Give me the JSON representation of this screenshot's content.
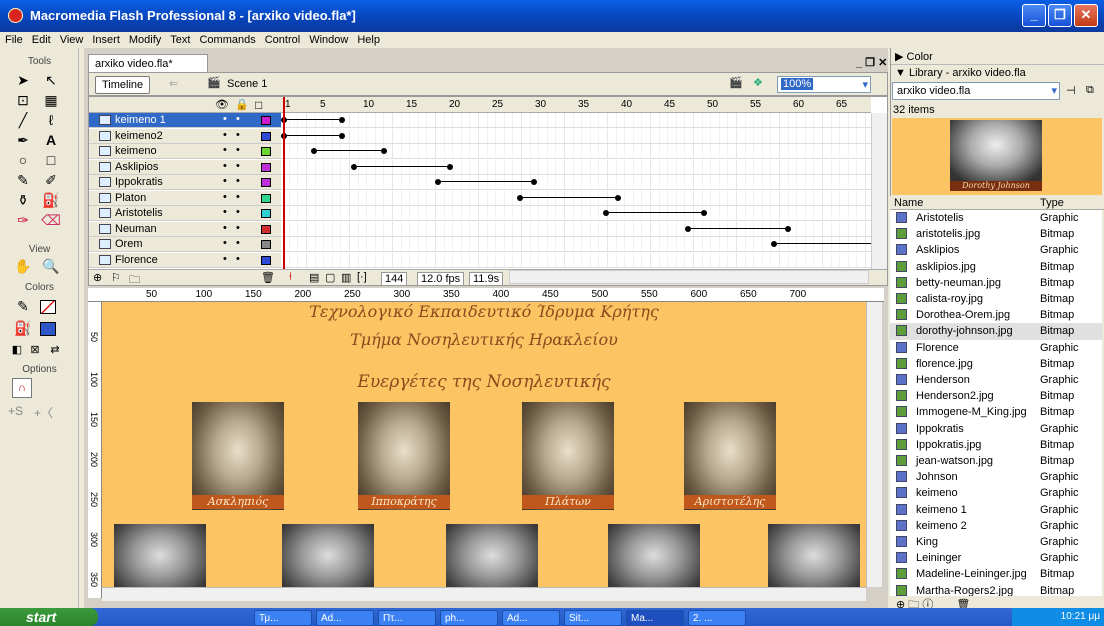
{
  "window": {
    "title": "Macromedia Flash Professional 8 - [arxiko video.fla*]"
  },
  "menu": [
    "File",
    "Edit",
    "View",
    "Insert",
    "Modify",
    "Text",
    "Commands",
    "Control",
    "Window",
    "Help"
  ],
  "tools": {
    "label": "Tools",
    "view": "View",
    "colors": "Colors",
    "options": "Options"
  },
  "document": {
    "tab": "arxiko video.fla*",
    "timeline_btn": "Timeline",
    "scene": "Scene 1",
    "zoom": "100%"
  },
  "layers": [
    "keimeno 1",
    "keimeno2",
    "keimeno",
    "Asklipios",
    "Ippokratis",
    "Platon",
    "Aristotelis",
    "Neuman",
    "Orem",
    "Florence"
  ],
  "frame_ticks": [
    "1",
    "5",
    "10",
    "15",
    "20",
    "25",
    "30",
    "35",
    "40",
    "45",
    "50",
    "55",
    "60",
    "65"
  ],
  "timeline_status": {
    "frame": "144",
    "fps": "12.0 fps",
    "time": "11.9s"
  },
  "ruler_ticks": [
    "50",
    "100",
    "150",
    "200",
    "250",
    "300",
    "350",
    "400",
    "450",
    "500",
    "550",
    "600",
    "650",
    "700"
  ],
  "vruler_ticks": [
    "50",
    "100",
    "150",
    "200",
    "250",
    "300",
    "350"
  ],
  "stage": {
    "line1": "Τεχνολογικό Εκπαιδευτικό Ίδρυμα Κρήτης",
    "line2": "Τμήμα Νοσηλευτικής Ηρακλείου",
    "line3": "Ευεργέτες της Νοσηλευτικής",
    "captions": [
      "Ασκληπιός",
      "Ιπποκράτης",
      "Πλάτων",
      "Αριστοτέλης"
    ]
  },
  "panels": {
    "color": "Color",
    "library_title": "Library - arxiko video.fla",
    "library_file": "arxiko video.fla",
    "items_count": "32 items",
    "preview_caption": "Dorothy Johnson",
    "col_name": "Name",
    "col_type": "Type"
  },
  "library": [
    {
      "name": "Aristotelis",
      "type": "Graphic"
    },
    {
      "name": "aristotelis.jpg",
      "type": "Bitmap"
    },
    {
      "name": "Asklipios",
      "type": "Graphic"
    },
    {
      "name": "asklipios.jpg",
      "type": "Bitmap"
    },
    {
      "name": "betty-neuman.jpg",
      "type": "Bitmap"
    },
    {
      "name": "calista-roy.jpg",
      "type": "Bitmap"
    },
    {
      "name": "Dorothea-Orem.jpg",
      "type": "Bitmap"
    },
    {
      "name": "dorothy-johnson.jpg",
      "type": "Bitmap"
    },
    {
      "name": "Florence",
      "type": "Graphic"
    },
    {
      "name": "florence.jpg",
      "type": "Bitmap"
    },
    {
      "name": "Henderson",
      "type": "Graphic"
    },
    {
      "name": "Henderson2.jpg",
      "type": "Bitmap"
    },
    {
      "name": "Immogene-M_King.jpg",
      "type": "Bitmap"
    },
    {
      "name": "Ippokratis",
      "type": "Graphic"
    },
    {
      "name": "Ippokratis.jpg",
      "type": "Bitmap"
    },
    {
      "name": "jean-watson.jpg",
      "type": "Bitmap"
    },
    {
      "name": "Johnson",
      "type": "Graphic"
    },
    {
      "name": "keimeno",
      "type": "Graphic"
    },
    {
      "name": "keimeno 1",
      "type": "Graphic"
    },
    {
      "name": "keimeno 2",
      "type": "Graphic"
    },
    {
      "name": "King",
      "type": "Graphic"
    },
    {
      "name": "Leininger",
      "type": "Graphic"
    },
    {
      "name": "Madeline-Leininger.jpg",
      "type": "Bitmap"
    },
    {
      "name": "Martha-Rogers2.jpg",
      "type": "Bitmap"
    }
  ],
  "taskbar": {
    "start": "start",
    "items": [
      "Τμ...",
      "Ad...",
      "Πτ...",
      "ph...",
      "Ad...",
      "Sit...",
      "Ma...",
      "2. ..."
    ],
    "clock": "10:21 μμ"
  }
}
